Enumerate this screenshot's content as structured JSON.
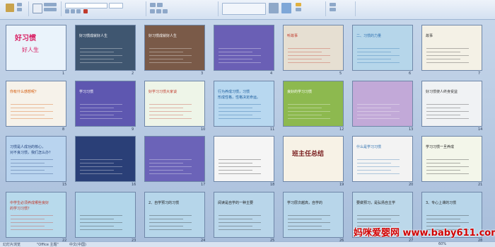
{
  "ribbon": {
    "groups": [
      "剪贴板",
      "幻灯片",
      "字体",
      "段落",
      "绘图",
      "编辑"
    ],
    "quick_styles_label": "快速样式"
  },
  "slides": [
    {
      "num": "1",
      "bg": "#eaf3fb",
      "title": "好习惯",
      "sub": "好人生",
      "accent": "#d81b60"
    },
    {
      "num": "2",
      "bg": "#3f5670",
      "title": "好习惯成就好人生",
      "sub": "",
      "accent": "#ffffff"
    },
    {
      "num": "3",
      "bg": "#7a5a48",
      "title": "好习惯成就好人生",
      "sub": "",
      "accent": "#ffffff"
    },
    {
      "num": "4",
      "bg": "#6a5fb5",
      "title": "",
      "sub": "",
      "accent": "#ffffff"
    },
    {
      "num": "5",
      "bg": "#e6dfd2",
      "title": "听故事",
      "sub": "",
      "accent": "#c0392b"
    },
    {
      "num": "6",
      "bg": "#b6d6ea",
      "title": "二、习惯的力量",
      "sub": "",
      "accent": "#2c6fb0"
    },
    {
      "num": "7",
      "bg": "#f4f1e6",
      "title": "故事",
      "sub": "",
      "accent": "#333333"
    },
    {
      "num": "8",
      "bg": "#f6f2ea",
      "title": "你有什么感想呢？",
      "sub": "",
      "accent": "#d35400"
    },
    {
      "num": "9",
      "bg": "#5e57b0",
      "title": "学习习惯",
      "sub": "",
      "accent": "#ffffff"
    },
    {
      "num": "10",
      "bg": "#eef5e8",
      "title": "好学习习惯大家谈",
      "sub": "",
      "accent": "#c0392b"
    },
    {
      "num": "11",
      "bg": "#b8d8f0",
      "title": "行为养成习惯，习惯",
      "sub": "形成性格，性格决定命运。",
      "accent": "#1a5c9c"
    },
    {
      "num": "12",
      "bg": "#8db94f",
      "title": "良好的学习习惯",
      "sub": "",
      "accent": "#ffffff"
    },
    {
      "num": "13",
      "bg": "#c2a9d8",
      "title": "",
      "sub": "",
      "accent": "#ffffff"
    },
    {
      "num": "14",
      "bg": "#f0f2f4",
      "title": "好习惯使人终身受益",
      "sub": "",
      "accent": "#333333"
    },
    {
      "num": "15",
      "bg": "#b9d4ef",
      "title": "习惯是人成功的核心，",
      "sub": "对不良习惯，我们怎么办？",
      "accent": "#1f3f7a"
    },
    {
      "num": "16",
      "bg": "#2a3f77",
      "title": "",
      "sub": "",
      "accent": "#ffffff"
    },
    {
      "num": "17",
      "bg": "#6b63b8",
      "title": "",
      "sub": "",
      "accent": "#ffffff"
    },
    {
      "num": "18",
      "bg": "#f5f5f5",
      "title": "",
      "sub": "",
      "accent": "#222222"
    },
    {
      "num": "19",
      "bg": "#f7f2e6",
      "title": "班主任总结",
      "sub": "",
      "accent": "#7a1f1f"
    },
    {
      "num": "20",
      "bg": "#f3f3f3",
      "title": "什么是学习习惯",
      "sub": "",
      "accent": "#2c6fb0"
    },
    {
      "num": "21",
      "bg": "#f3f6ea",
      "title": "学习习惯一旦养成",
      "sub": "",
      "accent": "#222222"
    },
    {
      "num": "22",
      "bg": "#b8daec",
      "title": "中学生必须养成哪些良好",
      "sub": "的学习习惯？",
      "accent": "#c0392b"
    },
    {
      "num": "23",
      "bg": "#b2d6ea",
      "title": "",
      "sub": "",
      "accent": "#222222"
    },
    {
      "num": "24",
      "bg": "#b6d6ea",
      "title": "2、自学预习的习惯",
      "sub": "",
      "accent": "#222222"
    },
    {
      "num": "25",
      "bg": "#b9d6ea",
      "title": "阅读是自学的一种主要",
      "sub": "",
      "accent": "#222222"
    },
    {
      "num": "26",
      "bg": "#b8d6ea",
      "title": "学习层次越高，自学的",
      "sub": "",
      "accent": "#222222"
    },
    {
      "num": "27",
      "bg": "#bcd8ea",
      "title": "要做预习，是弘扬自主学",
      "sub": "",
      "accent": "#222222"
    },
    {
      "num": "28",
      "bg": "#b8d6ea",
      "title": "3、专心上课的习惯",
      "sub": "",
      "accent": "#222222"
    }
  ],
  "watermark": "妈咪爱婴网 www.baby611.com",
  "status": {
    "view": "幻灯片浏览",
    "theme": "\"Office 主题\"",
    "language": "中文(中国)",
    "zoom": "60%"
  }
}
